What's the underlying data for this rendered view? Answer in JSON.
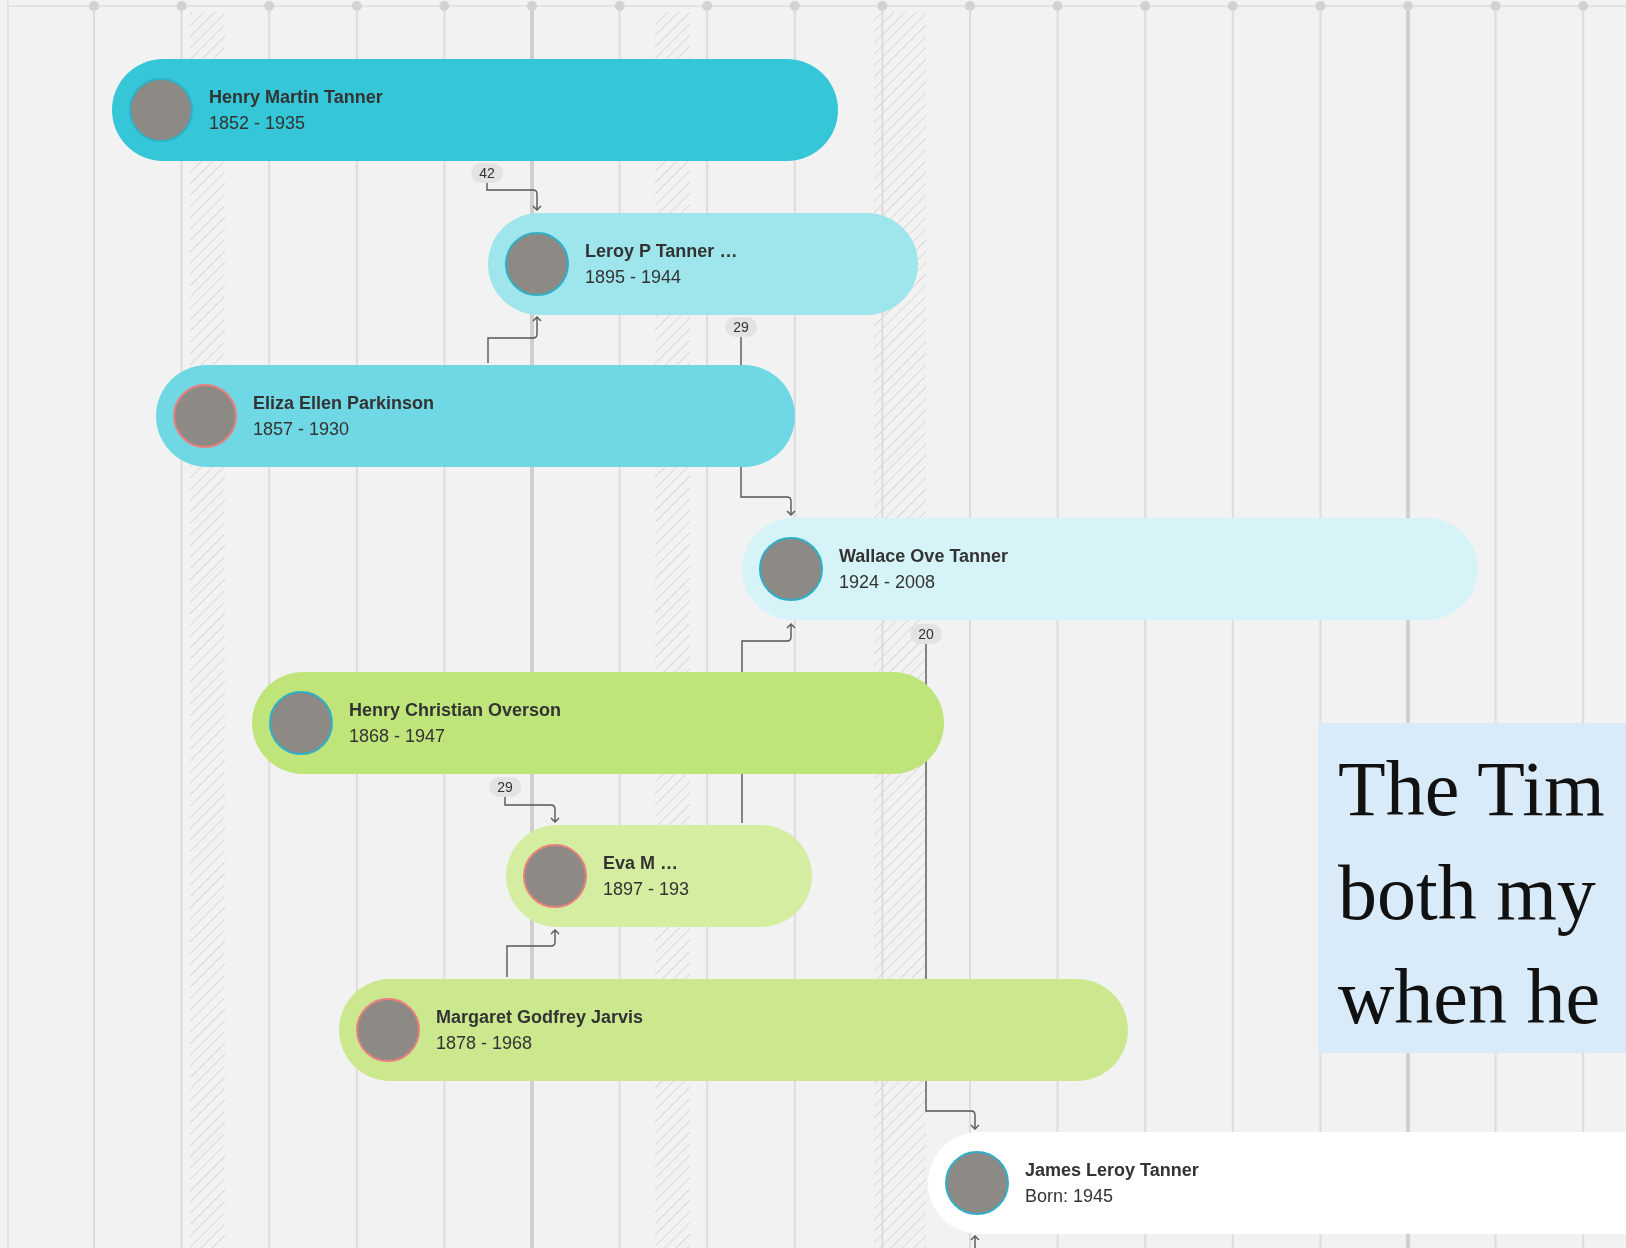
{
  "timeline": {
    "people": [
      {
        "name": "Henry Martin Tanner",
        "dates": "1852 - 1935",
        "color": "#35c6d8",
        "avatar": {
          "color": "#2fb0c6"
        }
      },
      {
        "name": "Leroy P Tanner …",
        "dates": "1895 - 1944",
        "color": "#9fe6ec",
        "avatar": {
          "color": "#2fb0c6"
        }
      },
      {
        "name": "Eliza Ellen Parkinson",
        "dates": "1857 - 1930",
        "color": "#70d8e4",
        "avatar": {
          "color": "#e8807e"
        }
      },
      {
        "name": "Wallace Ove Tanner",
        "dates": "1924 - 2008",
        "color": "#d6f3f7",
        "avatar": {
          "color": "#2fb0c6"
        }
      },
      {
        "name": "Henry Christian Overson",
        "dates": "1868 - 1947",
        "color": "#bfe47a",
        "avatar": {
          "color": "#2fb0c6"
        }
      },
      {
        "name": "Eva M …",
        "dates": "1897 - 193",
        "color": "#d4eda0",
        "avatar": {
          "color": "#e8807e"
        }
      },
      {
        "name": "Margaret Godfrey Jarvis",
        "dates": "1878 - 1968",
        "color": "#cbe88f",
        "avatar": {
          "color": "#e8807e"
        }
      },
      {
        "name": "James Leroy Tanner",
        "dates": "Born: 1945",
        "color": "#ffffff",
        "avatar": {
          "color": "#2fb0c6"
        }
      }
    ],
    "age_badges": [
      "42",
      "29",
      "20",
      "29"
    ]
  },
  "note": {
    "lines": [
      "The Tim",
      "both my",
      "when he"
    ]
  }
}
